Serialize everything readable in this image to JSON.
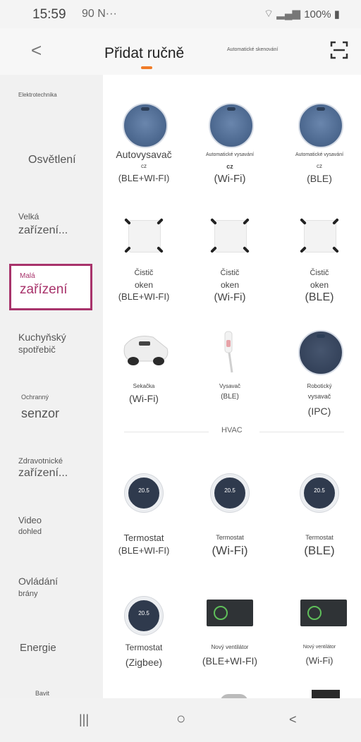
{
  "status_bar": {
    "time": "15:59",
    "network": "90 N···",
    "battery": "100%"
  },
  "header": {
    "back_glyph": "<",
    "title": "Přidat ručně",
    "auto_scan": "Automatické skenování"
  },
  "sidebar": {
    "items": [
      {
        "label": "Elektrotechnika"
      },
      {
        "label": "Osvětlení"
      },
      {
        "line1": "Velká",
        "line2": "zařízení..."
      },
      {
        "line1": "Malá",
        "line2": "zařízení",
        "selected": true
      },
      {
        "line1": "Kuchyňský",
        "line2": "spotřebič"
      },
      {
        "line1": "Ochranný",
        "line2": "senzor"
      },
      {
        "line1": "Zdravotnické",
        "line2": "zařízení..."
      },
      {
        "line1": "Video",
        "line2": "dohled"
      },
      {
        "line1": "Ovládání",
        "line2": "brány"
      },
      {
        "label": "Energie"
      },
      {
        "label": "Bavit"
      }
    ],
    "accent_color": "#a8336b"
  },
  "main": {
    "devices": [
      {
        "lines": [
          "Autovysavač",
          "cz",
          "(BLE+WI-FI)"
        ],
        "icon": "robot-vacuum-icon"
      },
      {
        "lines": [
          "Automatické vysavání",
          "cz",
          "(Wi-Fi)"
        ],
        "icon": "robot-vacuum-icon"
      },
      {
        "lines": [
          "Automatické vysavání",
          "cz",
          "(BLE)"
        ],
        "icon": "robot-vacuum-icon"
      },
      {
        "lines": [
          "Čistič",
          "oken",
          "(BLE+WI-FI)"
        ],
        "icon": "window-cleaner-icon"
      },
      {
        "lines": [
          "Čistič",
          "oken",
          "(Wi-Fi)"
        ],
        "icon": "window-cleaner-icon"
      },
      {
        "lines": [
          "Čistič",
          "oken",
          "(BLE)"
        ],
        "icon": "window-cleaner-icon"
      },
      {
        "lines": [
          "Sekačka",
          "(Wi-Fi)"
        ],
        "icon": "lawn-mower-icon"
      },
      {
        "lines": [
          "Vysavač",
          "(BLE)"
        ],
        "icon": "stick-vacuum-icon"
      },
      {
        "lines": [
          "Robotický",
          "vysavač",
          "(IPC)"
        ],
        "icon": "robot-vacuum-camera-icon"
      }
    ],
    "section_hvac": "HVAC",
    "hvac": [
      {
        "lines": [
          "Termostat",
          "(BLE+WI-FI)"
        ],
        "display": "20.5",
        "icon": "thermostat-icon"
      },
      {
        "lines": [
          "Termostat",
          "(Wi-Fi)"
        ],
        "display": "20.5",
        "icon": "thermostat-icon"
      },
      {
        "lines": [
          "Termostat",
          "(BLE)"
        ],
        "display": "20.5",
        "icon": "thermostat-icon"
      },
      {
        "lines": [
          "Termostat",
          "(Zigbee)"
        ],
        "display": "20.5",
        "icon": "thermostat-icon"
      },
      {
        "lines": [
          "Nový ventilátor",
          "(BLE+WI-FI)"
        ],
        "icon": "ventilator-icon"
      },
      {
        "lines": [
          "Nový ventilátor",
          "(Wi-Fi)"
        ],
        "icon": "ventilator-icon"
      }
    ]
  },
  "nav_bar": {
    "recents": "|||",
    "home": "○",
    "back": "<"
  },
  "colors": {
    "accent_orange": "#f07c28",
    "selected_border": "#a8336b"
  }
}
